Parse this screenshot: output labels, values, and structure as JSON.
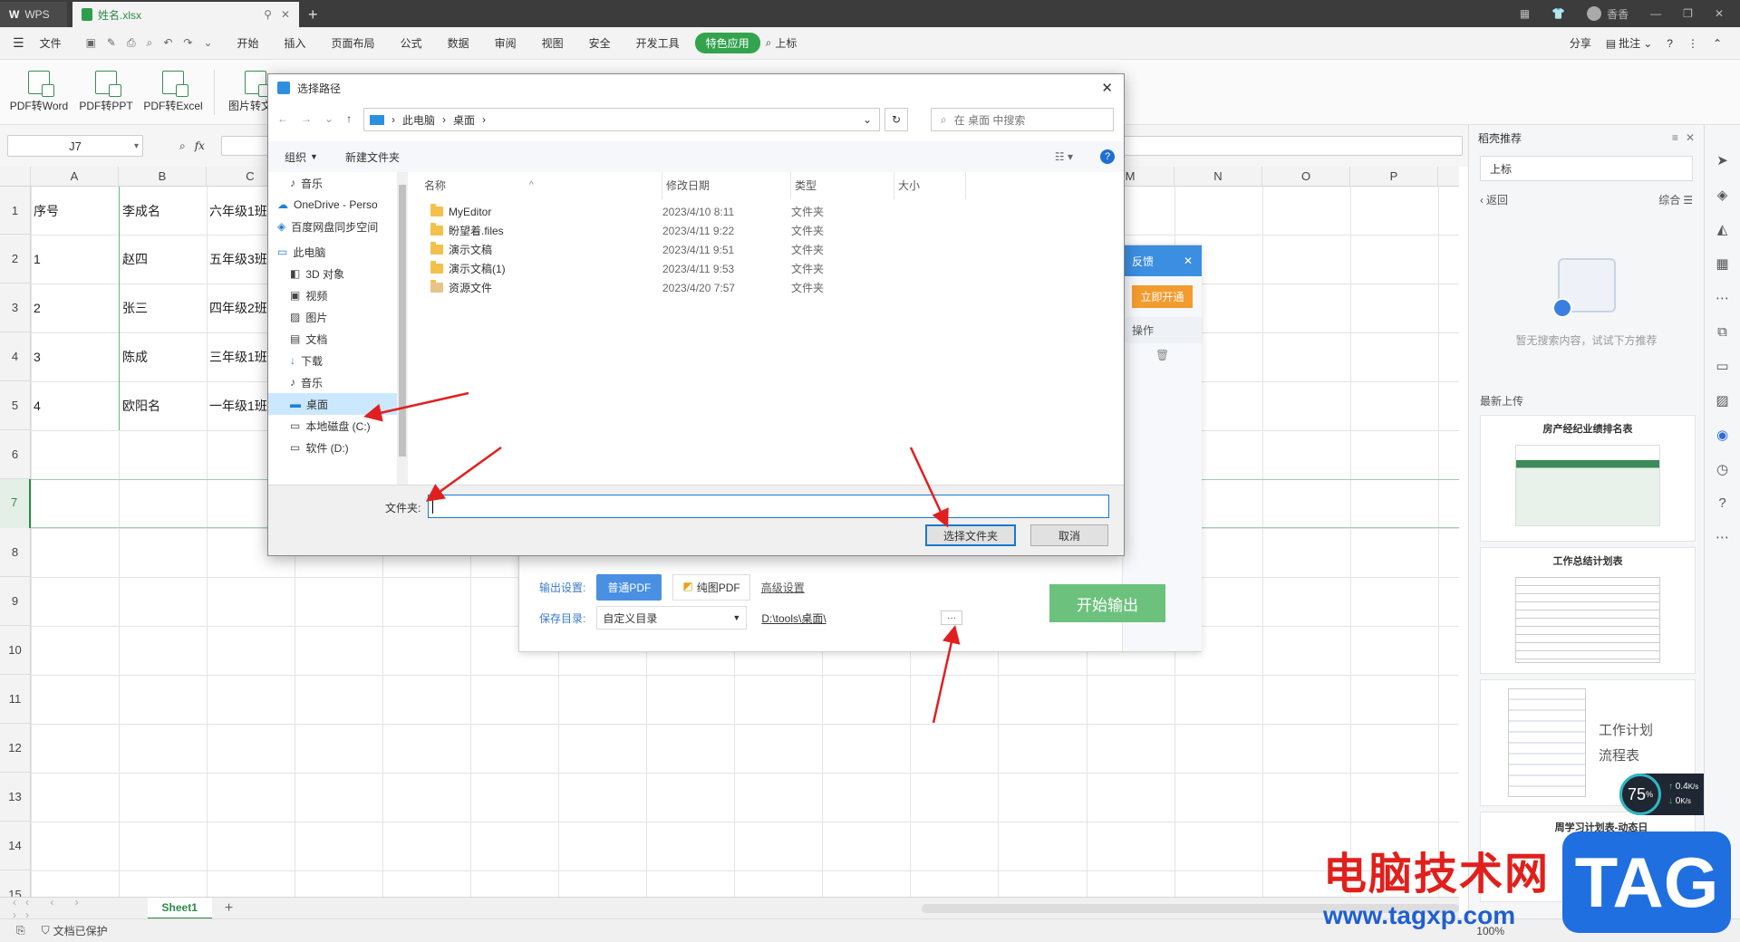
{
  "titlebar": {
    "wps_tab": "WPS",
    "file_tab": "姓名.xlsx",
    "new_tab": "+",
    "user": "香香"
  },
  "menu": {
    "items": [
      "文件",
      "开始",
      "插入",
      "页面布局",
      "公式",
      "数据",
      "审阅",
      "视图",
      "安全",
      "开发工具",
      "特色应用"
    ],
    "search_text": "上标",
    "share": "分享",
    "annotate": "批注"
  },
  "ribbon": {
    "buttons": [
      "PDF转Word",
      "PDF转PPT",
      "PDF转Excel",
      "图片转文字"
    ]
  },
  "formula": {
    "namebox": "J7",
    "fx": "fx"
  },
  "grid": {
    "columns": [
      "A",
      "B",
      "C",
      "M",
      "N",
      "O",
      "P"
    ],
    "rows": [
      "1",
      "2",
      "3",
      "4",
      "5",
      "6",
      "7",
      "8",
      "9",
      "10",
      "11",
      "12",
      "13",
      "14",
      "15"
    ],
    "col_a": [
      "序号",
      "1",
      "2",
      "3",
      "4"
    ],
    "col_b": [
      "李成名",
      "赵四",
      "张三",
      "陈成",
      "欧阳名"
    ],
    "col_c": [
      "六年级1班",
      "五年级3班",
      "四年级2班",
      "三年级1班",
      "一年级1班"
    ]
  },
  "sheetbar": {
    "sheet": "Sheet1",
    "add": "+"
  },
  "status": {
    "protected": "文档已保护",
    "zoom": "100%"
  },
  "rightpane": {
    "title": "稻壳推荐",
    "search_value": "上标",
    "back": "返回",
    "sort": "综合",
    "empty": "暂无搜索内容，试试下方推荐",
    "recent": "最新上传",
    "templates": [
      "房产经纪业绩排名表",
      "工作总结计划表",
      "工作计划流程表",
      "周学习计划表-动态日"
    ],
    "net_percent": "75",
    "net_up": "0.4",
    "net_down": "0",
    "net_unit": "K/s"
  },
  "export_panel": {
    "feedback": "反馈",
    "activate": "立即开通",
    "operation": "操作",
    "output_label": "输出设置:",
    "normal_pdf": "普通PDF",
    "pure_pdf": "纯图PDF",
    "advanced": "高级设置",
    "save_label": "保存目录:",
    "save_option": "自定义目录",
    "save_path": "D:\\tools\\桌面\\",
    "more": "···",
    "start": "开始输出"
  },
  "dialog": {
    "title": "选择路径",
    "breadcrumb": [
      "此电脑",
      "桌面"
    ],
    "search_placeholder": "在 桌面 中搜索",
    "organize": "组织",
    "new_folder": "新建文件夹",
    "nav": [
      {
        "label": "音乐",
        "icon": "music-icon"
      },
      {
        "label": "OneDrive - Perso",
        "icon": "cloud-icon"
      },
      {
        "label": "百度网盘同步空间",
        "icon": "baidu-icon"
      },
      {
        "label": "此电脑",
        "icon": "computer-icon"
      },
      {
        "label": "3D 对象",
        "icon": "cube-icon"
      },
      {
        "label": "视频",
        "icon": "video-icon"
      },
      {
        "label": "图片",
        "icon": "picture-icon"
      },
      {
        "label": "文档",
        "icon": "document-icon"
      },
      {
        "label": "下载",
        "icon": "download-icon"
      },
      {
        "label": "音乐",
        "icon": "music-icon"
      },
      {
        "label": "桌面",
        "icon": "desktop-icon"
      },
      {
        "label": "本地磁盘 (C:)",
        "icon": "drive-icon"
      },
      {
        "label": "软件 (D:)",
        "icon": "drive-icon"
      }
    ],
    "headers": [
      "名称",
      "修改日期",
      "类型",
      "大小"
    ],
    "files": [
      {
        "name": "MyEditor",
        "date": "2023/4/10 8:11",
        "type": "文件夹"
      },
      {
        "name": "盼望着.files",
        "date": "2023/4/11 9:22",
        "type": "文件夹"
      },
      {
        "name": "演示文稿",
        "date": "2023/4/11 9:51",
        "type": "文件夹"
      },
      {
        "name": "演示文稿(1)",
        "date": "2023/4/11 9:53",
        "type": "文件夹"
      },
      {
        "name": "资源文件",
        "date": "2023/4/20 7:57",
        "type": "文件夹"
      }
    ],
    "folder_label": "文件夹:",
    "folder_value": "",
    "select_button": "选择文件夹",
    "cancel_button": "取消"
  },
  "watermark": {
    "text": "电脑技术网",
    "url": "www.tagxp.com",
    "badge": "TAG"
  },
  "colors": {
    "accent_green": "#33a34e",
    "export_green": "#6cc27c",
    "link_blue": "#1e6fd9",
    "arrow_red": "#e02020",
    "watermark_red": "#e0201c"
  }
}
